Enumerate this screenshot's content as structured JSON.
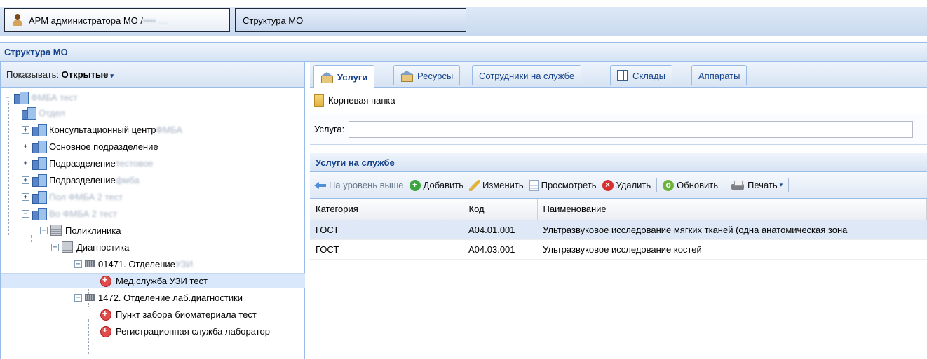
{
  "window_tabs": [
    {
      "label": "АРМ администратора МО / ",
      "label_masked": "•••• …",
      "icon": "person-icon"
    },
    {
      "label": "Структура МО"
    }
  ],
  "panel": {
    "title": "Структура МО"
  },
  "left": {
    "show_label": "Показывать: ",
    "show_value": "Открытые",
    "show_caret": "▾",
    "tree": [
      {
        "label": "ФМБА тест"
      },
      {
        "label": "Отдел"
      },
      {
        "label": "Консультационный центр ",
        "masked": "ФМБА"
      },
      {
        "label": "Основное подразделение"
      },
      {
        "label": "Подразделение ",
        "masked": "тестовое"
      },
      {
        "label": "Подразделение ",
        "masked": "фмба"
      },
      {
        "label": "",
        "masked": "Пол ФМБА 2 тест"
      },
      {
        "label": "",
        "masked": "Во ФМБА 2 тест"
      },
      {
        "label": "Поликлиника"
      },
      {
        "label": "Диагностика"
      },
      {
        "label": "01471. Отделение ",
        "masked": "УЗИ"
      },
      {
        "label": "Мед.служба УЗИ тест"
      },
      {
        "label": "1472. Отделение лаб.диагностики"
      },
      {
        "label": "Пункт забора биоматериала тест"
      },
      {
        "label": "Регистрационная служба лаборатор"
      }
    ]
  },
  "tabs": [
    "Услуги",
    "Ресурсы",
    "Сотрудники на службе",
    "Склады",
    "Аппараты"
  ],
  "crumb": "Корневая папка",
  "filter": {
    "label": "Услуга:",
    "value": ""
  },
  "grid": {
    "title": "Услуги на службе",
    "toolbar": {
      "up": "На уровень выше",
      "add": "Добавить",
      "edit": "Изменить",
      "view": "Просмотреть",
      "delete": "Удалить",
      "refresh": "Обновить",
      "print": "Печать"
    },
    "columns": [
      "Категория",
      "Код",
      "Наименование"
    ],
    "rows": [
      {
        "category": "ГОСТ",
        "code": "A04.01.001",
        "name": "Ультразвуковое исследование мягких тканей (одна анатомическая зона"
      },
      {
        "category": "ГОСТ",
        "code": "A04.03.001",
        "name": "Ультразвуковое исследование костей"
      }
    ]
  }
}
